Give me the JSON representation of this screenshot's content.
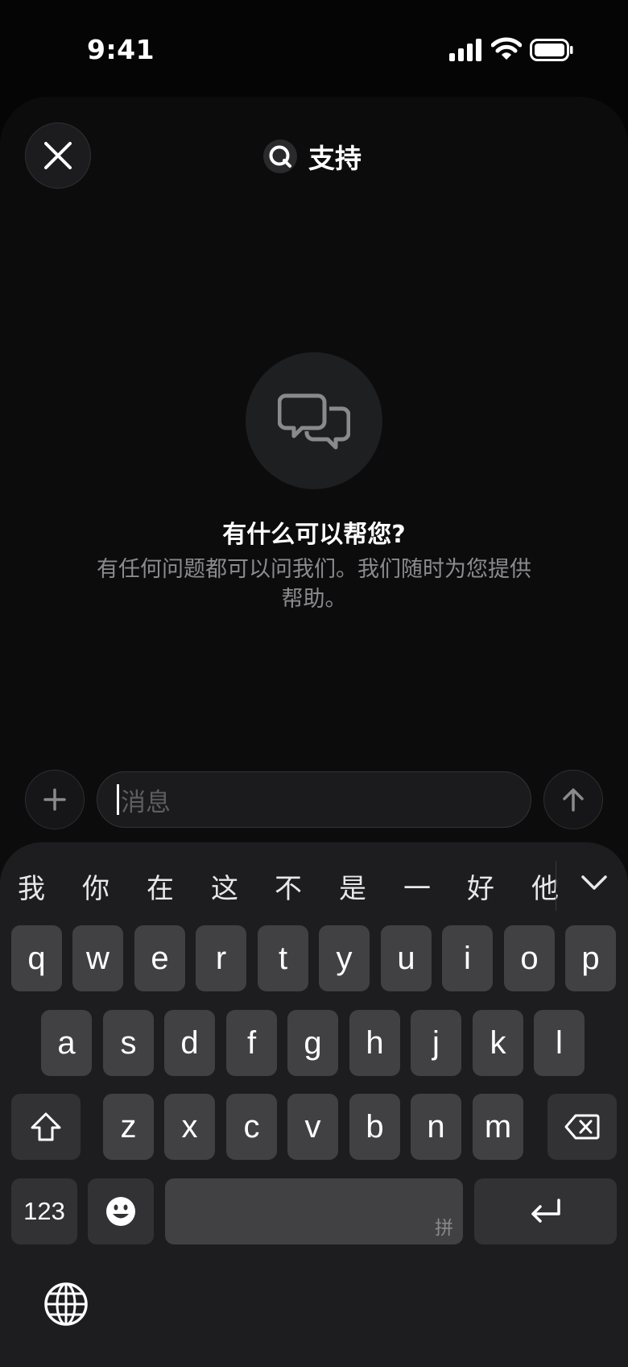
{
  "status_bar": {
    "time": "9:41"
  },
  "header": {
    "title": "支持"
  },
  "empty_state": {
    "title": "有什么可以帮您?",
    "description": "有任何问题都可以问我们。我们随时为您提供帮助。"
  },
  "composer": {
    "placeholder": "消息"
  },
  "keyboard": {
    "candidates": [
      "我",
      "你",
      "在",
      "这",
      "不",
      "是",
      "一",
      "好",
      "他"
    ],
    "row1": [
      "q",
      "w",
      "e",
      "r",
      "t",
      "y",
      "u",
      "i",
      "o",
      "p"
    ],
    "row2": [
      "a",
      "s",
      "d",
      "f",
      "g",
      "h",
      "j",
      "k",
      "l"
    ],
    "row3": [
      "z",
      "x",
      "c",
      "v",
      "b",
      "n",
      "m"
    ],
    "numbers_label": "123",
    "space_hint": "拼"
  },
  "icons": {
    "close": "close-icon",
    "brand": "brand-logo-icon",
    "chat": "chat-bubbles-icon",
    "plus": "plus-icon",
    "send": "arrow-up-icon",
    "shift": "shift-icon",
    "delete": "backspace-icon",
    "emoji": "emoji-icon",
    "return": "return-icon",
    "globe": "globe-icon",
    "collapse": "chevron-down-icon"
  },
  "colors": {
    "background": "#050505",
    "sheet": "#0c0c0d",
    "key": "#414143",
    "key_fn": "#323234",
    "muted_text": "#8b8b8f"
  }
}
